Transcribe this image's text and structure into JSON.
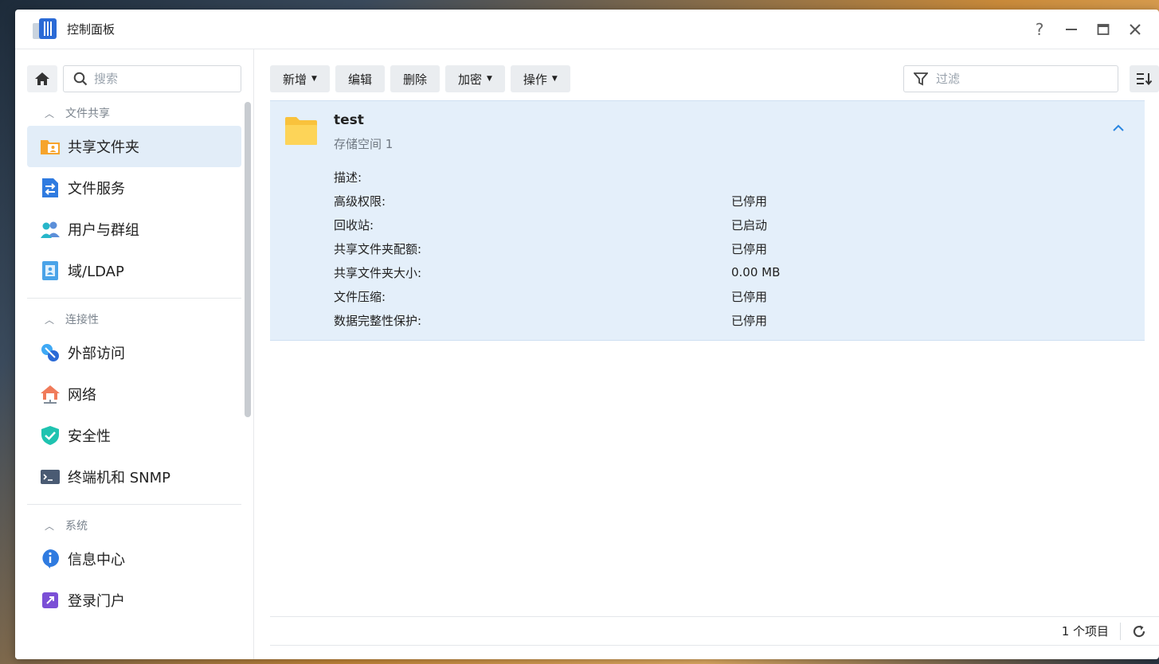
{
  "window": {
    "title": "控制面板",
    "help_symbol": "?",
    "minimize_symbol": "—",
    "close_symbol": "✕"
  },
  "sidebar": {
    "search_placeholder": "搜索",
    "sections": [
      {
        "title": "文件共享",
        "items": [
          {
            "label": "共享文件夹",
            "icon": "shared-folder-icon",
            "active": true
          },
          {
            "label": "文件服务",
            "icon": "file-services-icon"
          },
          {
            "label": "用户与群组",
            "icon": "users-groups-icon"
          },
          {
            "label": "域/LDAP",
            "icon": "domain-ldap-icon"
          }
        ]
      },
      {
        "title": "连接性",
        "items": [
          {
            "label": "外部访问",
            "icon": "external-access-icon"
          },
          {
            "label": "网络",
            "icon": "network-icon"
          },
          {
            "label": "安全性",
            "icon": "security-icon"
          },
          {
            "label": "终端机和 SNMP",
            "icon": "terminal-snmp-icon"
          }
        ]
      },
      {
        "title": "系统",
        "items": [
          {
            "label": "信息中心",
            "icon": "info-center-icon"
          },
          {
            "label": "登录门户",
            "icon": "login-portal-icon"
          }
        ]
      }
    ]
  },
  "toolbar": {
    "create_label": "新增",
    "edit_label": "编辑",
    "delete_label": "删除",
    "encrypt_label": "加密",
    "action_label": "操作",
    "filter_placeholder": "过滤"
  },
  "shared_folder": {
    "name": "test",
    "location": "存储空间 1",
    "details": [
      {
        "key": "描述:",
        "value": ""
      },
      {
        "key": "高级权限:",
        "value": "已停用"
      },
      {
        "key": "回收站:",
        "value": "已启动"
      },
      {
        "key": "共享文件夹配额:",
        "value": "已停用"
      },
      {
        "key": "共享文件夹大小:",
        "value": "0.00 MB"
      },
      {
        "key": "文件压缩:",
        "value": "已停用"
      },
      {
        "key": "数据完整性保护:",
        "value": "已停用"
      }
    ]
  },
  "footer": {
    "item_count": "1 个项目"
  },
  "colors": {
    "accent": "#2a6ad6",
    "selected_row": "#e4effa",
    "folder": "#f9c23c"
  }
}
